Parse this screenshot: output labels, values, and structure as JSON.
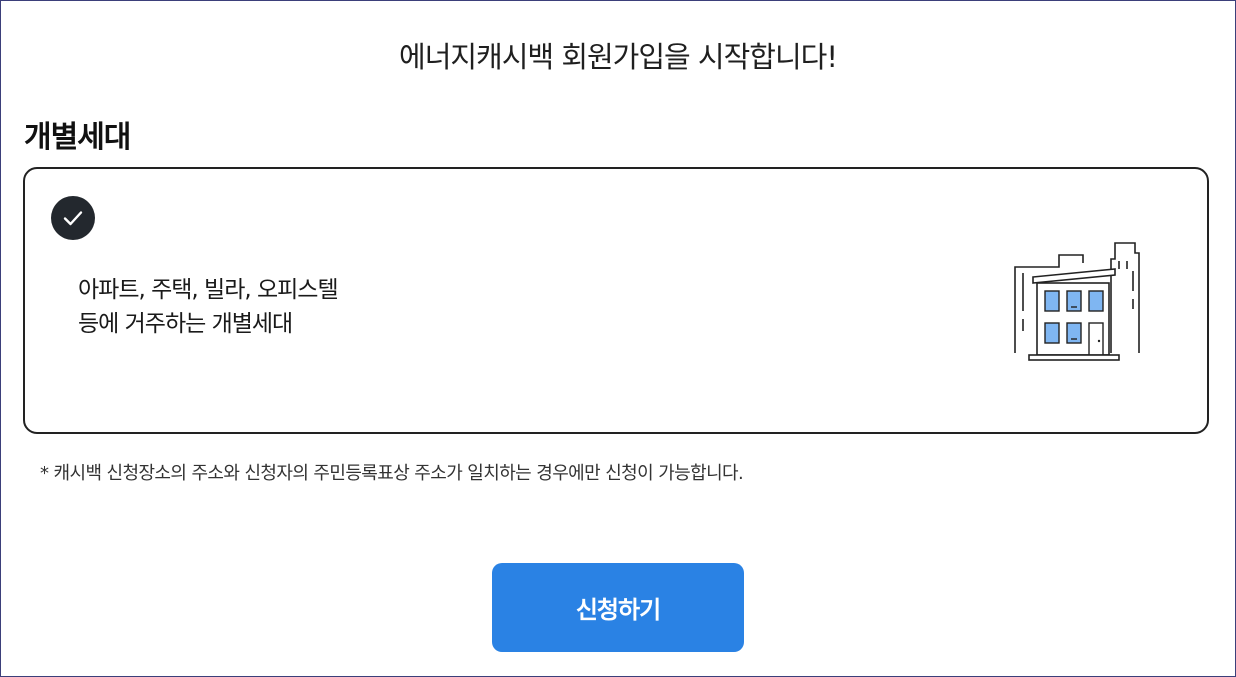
{
  "header": {
    "title": "에너지캐시백 회원가입을 시작합니다!"
  },
  "section": {
    "title": "개별세대"
  },
  "option_card": {
    "selected": true,
    "check_icon": "check-icon",
    "description_line1": "아파트, 주택, 빌라, 오피스텔",
    "description_line2": "등에 거주하는 개별세대",
    "illustration_icon": "building-icon"
  },
  "note": {
    "text": "*  캐시백 신청장소의 주소와 신청자의 주민등록표상 주소가 일치하는 경우에만 신청이 가능합니다."
  },
  "actions": {
    "submit_label": "신청하기"
  },
  "colors": {
    "primary_button": "#2a82e4",
    "check_badge": "#23282e",
    "window_fill": "#7fb6f2",
    "frame_border": "#3b3f7a"
  }
}
